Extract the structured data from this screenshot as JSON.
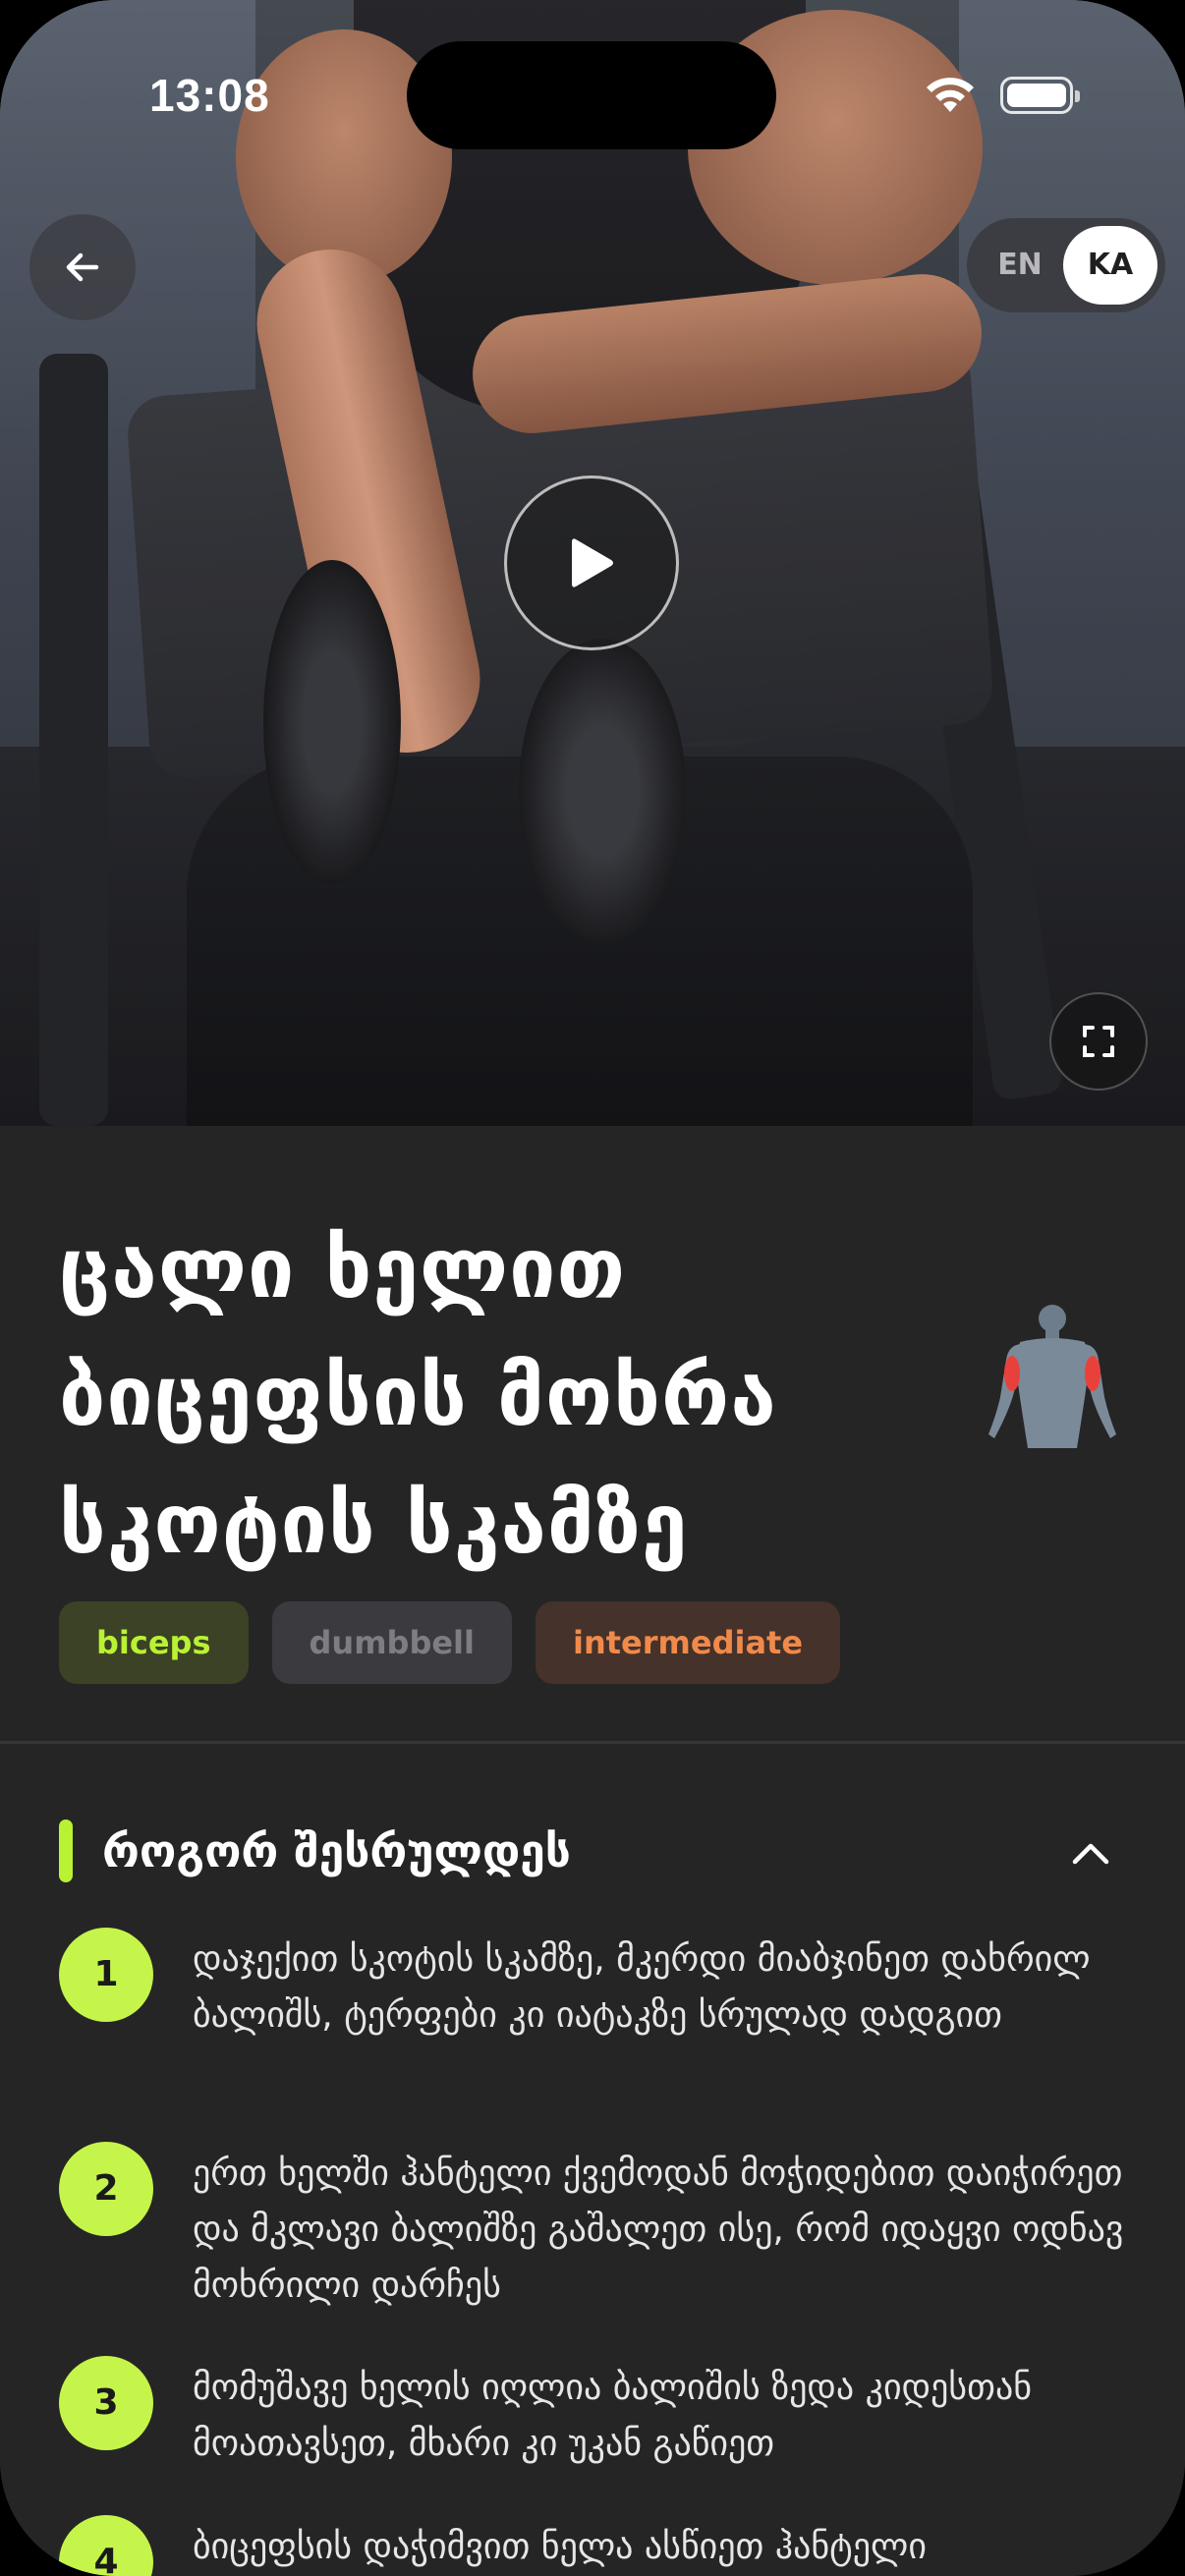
{
  "status_bar": {
    "time": "13:08"
  },
  "language": {
    "en": "EN",
    "ka": "KA",
    "selected": "KA"
  },
  "exercise": {
    "title": "ცალი ხელით ბიცეფსის მოხრა სკოტის სკამზე",
    "tags": {
      "muscle": "biceps",
      "equipment": "dumbbell",
      "level": "intermediate"
    }
  },
  "instructions": {
    "heading": "როგორ შესრულდეს",
    "steps": [
      {
        "number": "1",
        "text": "დაჯექით სკოტის სკამზე, მკერდი მიაბჯინეთ დახრილ ბალიშს, ტერფები კი იატაკზე სრულად დადგით"
      },
      {
        "number": "2",
        "text": "ერთ ხელში ჰანტელი ქვემოდან მოჭიდებით დაიჭირეთ და მკლავი ბალიშზე გაშალეთ ისე, რომ იდაყვი ოდნავ მოხრილი დარჩეს"
      },
      {
        "number": "3",
        "text": "მომუშავე ხელის იღლია ბალიშის ზედა კიდესთან მოათავსეთ, მხარი კი უკან გაწიეთ"
      },
      {
        "number": "4",
        "text": "ბიცეფსის დაჭიმვით ნელა ასწიეთ ჰანტელი"
      }
    ]
  },
  "colors": {
    "accent": "#b9f233",
    "background": "#252525",
    "level": "#f08a4b"
  },
  "icons": {
    "back": "arrow-left-icon",
    "play": "play-icon",
    "fullscreen": "fullscreen-icon",
    "collapse": "chevron-up-icon",
    "muscle": "muscle-diagram-icon"
  }
}
